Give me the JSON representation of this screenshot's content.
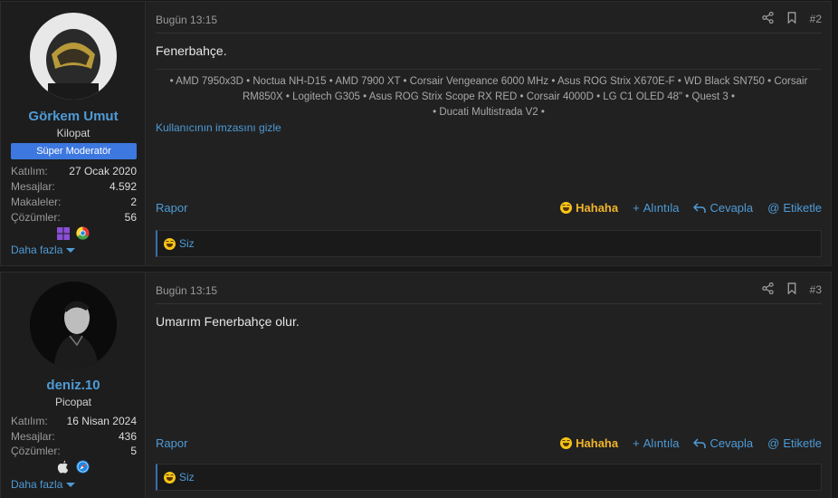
{
  "posts": [
    {
      "user": {
        "name": "Görkem Umut",
        "title": "Kilopat",
        "role": "Süper Moderatör",
        "stats": [
          {
            "label": "Katılım:",
            "value": "27 Ocak 2020"
          },
          {
            "label": "Mesajlar:",
            "value": "4.592"
          },
          {
            "label": "Makaleler:",
            "value": "2"
          },
          {
            "label": "Çözümler:",
            "value": "56"
          }
        ],
        "os_icons": [
          "windows-icon",
          "chrome-icon"
        ],
        "more": "Daha fazla"
      },
      "date": "Bugün 13:15",
      "number": "#2",
      "message": "Fenerbahçe.",
      "signature": {
        "line1": "• AMD 7950x3D • Noctua NH-D15 • AMD 7900 XT • Corsair Vengeance 6000 MHz • Asus ROG Strix X670E-F • WD Black SN750 • Corsair",
        "line2": "RM850X • Logitech G305 • Asus ROG Strix Scope RX RED • Corsair 4000D • LG C1 OLED 48\" • Quest 3 •",
        "line3": "• Ducati Multistrada V2 •"
      },
      "hide_signature": "Kullanıcının imzasını gizle",
      "actions": {
        "report": "Rapor",
        "reaction": "Hahaha",
        "quote": "Alıntıla",
        "reply": "Cevapla",
        "tag": "Etiketle"
      },
      "reactions": {
        "who": "Siz"
      }
    },
    {
      "user": {
        "name": "deniz.10",
        "title": "Picopat",
        "stats": [
          {
            "label": "Katılım:",
            "value": "16 Nisan 2024"
          },
          {
            "label": "Mesajlar:",
            "value": "436"
          },
          {
            "label": "Çözümler:",
            "value": "5"
          }
        ],
        "os_icons": [
          "apple-icon",
          "safari-icon"
        ],
        "more": "Daha fazla"
      },
      "date": "Bugün 13:15",
      "number": "#3",
      "message": "Umarım Fenerbahçe olur.",
      "actions": {
        "report": "Rapor",
        "reaction": "Hahaha",
        "quote": "Alıntıla",
        "reply": "Cevapla",
        "tag": "Etiketle"
      },
      "reactions": {
        "who": "Siz"
      }
    }
  ],
  "colors": {
    "accent": "#4e9bd6",
    "role_badge": "#3d78e0",
    "reaction": "#f0b429"
  }
}
